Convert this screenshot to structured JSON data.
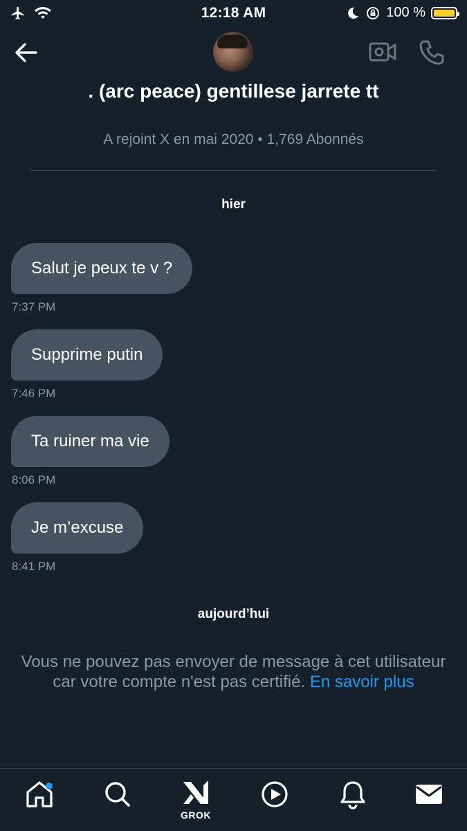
{
  "status_bar": {
    "time": "12:18 AM",
    "battery_text": "100 %",
    "battery_level": 1.0,
    "icons": [
      "airplane-icon",
      "wifi-icon",
      "moon-icon",
      "orientation-lock-icon",
      "battery-icon"
    ]
  },
  "header": {
    "contact_name": ". (arc peace) gentillese jarrete tt",
    "contact_meta": "A rejoint X en mai 2020 • 1,769 Abonnés",
    "icons": [
      "back-arrow-icon",
      "avatar",
      "video-call-icon",
      "phone-call-icon"
    ]
  },
  "conversation": {
    "day_labels": [
      "hier",
      "aujourd’hui"
    ],
    "messages": [
      {
        "text": "Salut je peux te v ?",
        "time": "7:37 PM"
      },
      {
        "text": "Supprime putin",
        "time": "7:46 PM"
      },
      {
        "text": "Ta ruiner ma vie",
        "time": "8:06 PM"
      },
      {
        "text": "Je m’excuse",
        "time": "8:41 PM"
      }
    ]
  },
  "notice": {
    "text": "Vous ne pouvez pas envoyer de message à cet utilisateur car votre compte n'est pas certifié.",
    "link": "En savoir plus"
  },
  "tab_bar": {
    "grok_label": "GROK",
    "items": [
      "home-icon",
      "search-icon",
      "grok-icon",
      "video-play-icon",
      "notifications-icon",
      "messages-icon"
    ]
  },
  "colors": {
    "background": "#15202b",
    "bubble": "#475360",
    "secondary_text": "#8b98a5",
    "accent": "#1d9bf0",
    "battery": "#f7d02c"
  }
}
